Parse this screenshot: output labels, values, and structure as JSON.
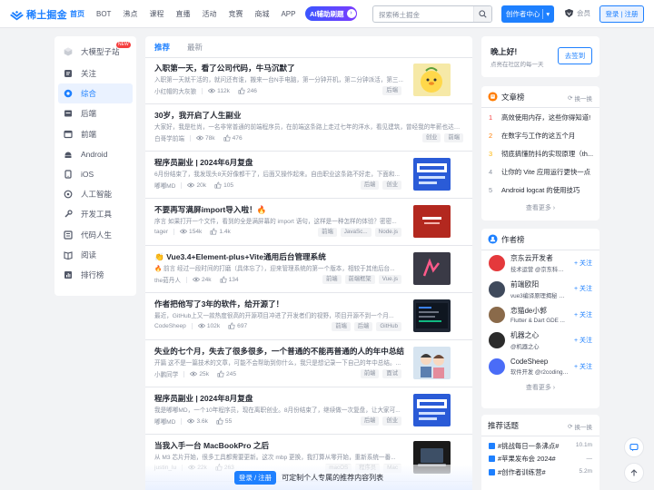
{
  "header": {
    "logo_text": "稀土掘金",
    "nav": [
      "首页",
      "BOT",
      "沸点",
      "课程",
      "直播",
      "活动",
      "竞赛",
      "商城",
      "APP",
      "插件"
    ],
    "ai_badge": "AI辅助刷题",
    "search_placeholder": "探索稀土掘金",
    "creator_label": "创作者中心",
    "member_label": "会员",
    "login_label": "登录 | 注册"
  },
  "sidebar": {
    "items": [
      {
        "label": "大模型子站",
        "icon": "cube-icon",
        "badge": "NEW"
      },
      {
        "label": "关注",
        "icon": "follow-icon"
      },
      {
        "label": "综合",
        "icon": "comprehensive-icon"
      },
      {
        "label": "后端",
        "icon": "backend-icon"
      },
      {
        "label": "前端",
        "icon": "frontend-icon"
      },
      {
        "label": "Android",
        "icon": "android-icon"
      },
      {
        "label": "iOS",
        "icon": "ios-icon"
      },
      {
        "label": "人工智能",
        "icon": "ai-icon"
      },
      {
        "label": "开发工具",
        "icon": "tools-icon"
      },
      {
        "label": "代码人生",
        "icon": "code-life-icon"
      },
      {
        "label": "阅读",
        "icon": "reading-icon"
      },
      {
        "label": "排行榜",
        "icon": "ranking-icon"
      }
    ]
  },
  "feed": {
    "tabs": [
      "推荐",
      "最新"
    ],
    "articles": [
      {
        "title": "入职第一天，看了公司代码，牛马沉默了",
        "abstract": "入职第一天就干活的，就问还有谁，搬来一台N手电脑，第一分钟开机，第二分钟派活，第三...",
        "author": "小红帽的大灰狼",
        "views": "112k",
        "likes": "246",
        "tags": [
          "后端"
        ],
        "thumb": "chick"
      },
      {
        "title": "30岁，我开启了人生副业",
        "abstract": "大家好，我是杜尚，一名非常普通的前端程序员，在前端这条路上走过七年的洋水，看见建筑，曾经我的年薪也达到...",
        "author": "白哥学前端",
        "views": "78k",
        "likes": "476",
        "tags": [
          "创业",
          "前端"
        ],
        "thumb": null
      },
      {
        "title": "程序员副业 | 2024年6月复盘",
        "abstract": "6月份结束了，我发现头8天好像都干了，后面又操作起来。自由职业这条路不好走，下面和...",
        "author": "嘟嘟MD",
        "views": "20k",
        "likes": "105",
        "tags": [
          "后端",
          "创业"
        ],
        "thumb": "blue-card"
      },
      {
        "title": "不要再写满屏import导入啦！🔥",
        "abstract": "序言 如果打开一个文件，看到的全是满屏幕的 import 语句，这样是一种怎样的体验？密密...",
        "author": "tager",
        "views": "154k",
        "likes": "1.4k",
        "tags": [
          "前端",
          "JavaSc...",
          "Node.js"
        ],
        "thumb": "import"
      },
      {
        "title": "👏 Vue3.4+Element-plus+Vite通用后台管理系统",
        "abstract": "🔥 前言 经过一段时间的打磨（具体忘了），迎来管理系统的第一个版本，相较于其他后台...",
        "author": "the茹丹人",
        "views": "24k",
        "likes": "134",
        "tags": [
          "前端",
          "前端框架",
          "Vue.js"
        ],
        "thumb": "dark"
      },
      {
        "title": "作者把他写了3年的软件，给开源了！",
        "abstract": "最近，GitHub上又一款热度很高的开源项目冲进了开发者们的视野，项目开源不到一个月...",
        "author": "CodeSheep",
        "views": "102k",
        "likes": "697",
        "tags": [
          "前端",
          "后端",
          "GitHub"
        ],
        "thumb": "screen"
      },
      {
        "title": "失业的七个月，失去了很多很多，一个普通的不能再普通的人的年中总结",
        "abstract": "开篇 这不是一篇技术的文章，可能不会帮助到你什么，我只是想记录一下自己的年中总结。...",
        "author": "小鹏同学",
        "views": "25k",
        "likes": "245",
        "tags": [
          "前端",
          "面试"
        ],
        "thumb": "anime"
      },
      {
        "title": "程序员副业 | 2024年8月复盘",
        "abstract": "我是嘟嘟MD，一个10年程序员，现在离职创业。8月份结束了，继续做一次复盘，让大家可...",
        "author": "嘟嘟MD",
        "views": "3.6k",
        "likes": "55",
        "tags": [
          "后端",
          "创业"
        ],
        "thumb": "blue-card"
      },
      {
        "title": "当我入手一台 MacBookPro 之后",
        "abstract": "从 M3 芯片开始，很多工具都需要更新。这次 mbp 更换，我打算从零开始，重新系统一番...",
        "author": "justin_lu",
        "views": "22k",
        "likes": "263",
        "tags": [
          "macOS",
          "程序员",
          "Mac"
        ],
        "thumb": "mac"
      }
    ],
    "login_banner_btn": "登录 / 注册",
    "login_banner_text": "可定制个人专属的推荐内容列表"
  },
  "greet": {
    "title": "晚上好!",
    "subtitle": "点亮在社区的每一天",
    "signin_label": "去签到"
  },
  "articles_rank": {
    "title": "文章榜",
    "swap": "换一换",
    "items": [
      "高效使用内存，这些你得知道!",
      "在数字与工作的这五个月",
      "彻底搞懂防抖的实现原理（th...",
      "让你的 Vite 应用运行更快一点",
      "Android logcat 的使用技巧"
    ],
    "more": "查看更多"
  },
  "authors_rank": {
    "title": "作者榜",
    "items": [
      {
        "name": "京东云开发者",
        "desc": "技术运营 @京东科技信...",
        "follow": "+ 关注",
        "color": "#e4393c"
      },
      {
        "name": "前端欧阳",
        "desc": "vue3编译原理揭秘 作...",
        "follow": "+ 关注",
        "color": "#3f4a5c"
      },
      {
        "name": "恋猫de小郭",
        "desc": "Flutter & Dart GDE ...",
        "follow": "+ 关注",
        "color": "#8a6a4a"
      },
      {
        "name": "机器之心",
        "desc": "@机器之心",
        "follow": "+ 关注",
        "color": "#2b2b2b"
      },
      {
        "name": "CodeSheep",
        "desc": "软件开发 @r2coding.c...",
        "follow": "+ 关注",
        "color": "#4a6cf7"
      }
    ],
    "more": "查看更多"
  },
  "topics": {
    "title": "推荐话题",
    "swap": "换一换",
    "items": [
      {
        "label": "#挑战每日一条沸点#",
        "count": "10.1m"
      },
      {
        "label": "#苹果发布会 2024#",
        "count": "—"
      },
      {
        "label": "#创作者训练营#",
        "count": "5.2m"
      }
    ]
  }
}
